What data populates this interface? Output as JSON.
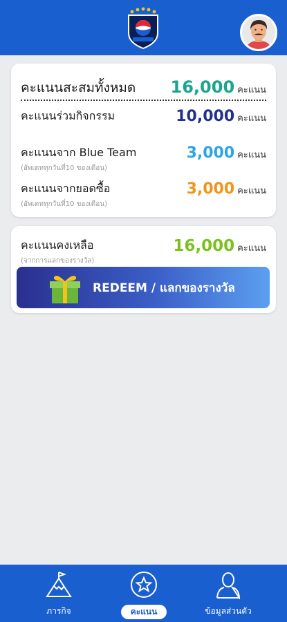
{
  "colors": {
    "primary_blue": "#1a5fd0",
    "teal": "#1aa58f",
    "navy": "#22308c",
    "light_blue": "#2ba6e3",
    "orange": "#f0941a",
    "green": "#7bc21e"
  },
  "summary": {
    "total_label": "คะแนนสะสมทั้งหมด",
    "total_value": "16,000",
    "unit": "คะแนน",
    "activity_label": "คะแนนร่วมกิจกรรม",
    "activity_value": "10,000",
    "blueteam_label": "คะแนนจาก Blue Team",
    "blueteam_note": "(อัพเดททุกวันที่10 ของเดือน)",
    "blueteam_value": "3,000",
    "purchase_label": "คะแนนจากยอดซื้อ",
    "purchase_note": "(อัพเดททุกวันที่10 ของเดือน)",
    "purchase_value": "3,000"
  },
  "remaining": {
    "label": "คะแนนคงเหลือ",
    "note": "(จากการแลกของรางวัล)",
    "value": "16,000",
    "unit": "คะแนน",
    "redeem_button": "REDEEM / แลกของรางวัล"
  },
  "nav": {
    "items": [
      {
        "label": "ภารกิจ",
        "icon": "mountain-flag-icon"
      },
      {
        "label": "คะแนน",
        "icon": "star-circle-icon",
        "active": true
      },
      {
        "label": "ข้อมูลส่วนตัว",
        "icon": "user-profile-icon"
      }
    ]
  }
}
